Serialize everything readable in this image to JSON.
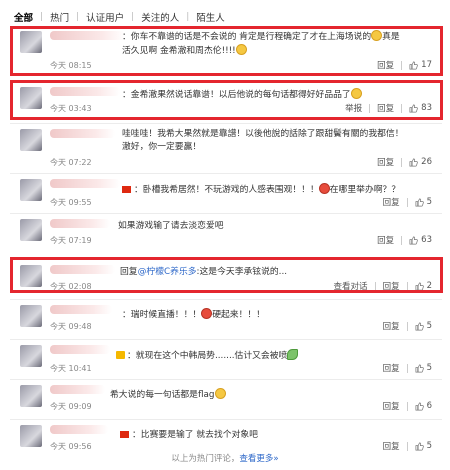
{
  "tabs": [
    "全部",
    "热门",
    "认证用户",
    "关注的人",
    "陌生人"
  ],
  "comments": [
    {
      "text": "：你车不靠谱的话是不会说的 肯定是行程确定了才在上海场说的",
      "text2": "真是活久见啊 金希澈和周杰伦!!!!",
      "time": "今天 08:15",
      "reply": "回复",
      "likes": "17"
    },
    {
      "text": "：金希澈果然说话靠谱！以后他说的每句话都得好好品品了",
      "time": "今天 03:43",
      "report": "举报",
      "reply": "回复",
      "likes": "83"
    },
    {
      "text": "哇哇哇！我希大果然就是靠譜！以後他說的話除了跟甜鬢有關的我都信！澈好，你",
      "text2": "一定要贏！",
      "time": "今天 07:22",
      "reply": "回复",
      "likes": "26"
    },
    {
      "text": "：卧槽我希居然！不玩游戏的人感表围观！！！",
      "text_b": "在哪里举办啊？？",
      "time": "今天 09:55",
      "reply": "回复",
      "likes": "5"
    },
    {
      "text": "如果游戏输了请去淡恋爱吧",
      "time": "今天 07:19",
      "reply": "回复",
      "likes": "63"
    },
    {
      "text_prefix": "回复",
      "at": "@柠檬C养乐多",
      "text": ":这是今天李承铉说的...",
      "time": "今天 02:08",
      "conversation": "查看对话",
      "reply": "回复",
      "likes": "2"
    },
    {
      "text": "：瑞时候直播！！！",
      "text_b": "硬起来！！！",
      "time": "今天 09:48",
      "reply": "回复",
      "likes": "5"
    },
    {
      "text": "：就现在这个中韩局势.......估计又会被喷",
      "time": "今天 10:41",
      "reply": "回复",
      "likes": "5"
    },
    {
      "text": "希大说的每一句话都是flag",
      "time": "今天 09:09",
      "reply": "回复",
      "likes": "6"
    },
    {
      "text": "：比赛要是输了 就去找个对象吧",
      "time": "今天 09:56",
      "reply": "回复",
      "likes": "5"
    }
  ],
  "footer": {
    "prefix": "以上为热门评论，",
    "more": "查看更多",
    "suffix": "»"
  }
}
